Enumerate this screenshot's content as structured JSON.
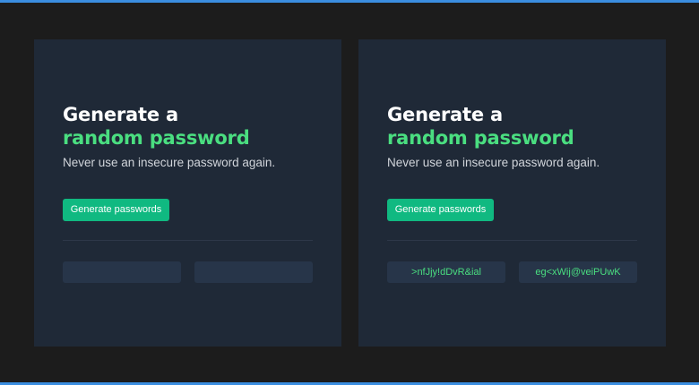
{
  "cards": [
    {
      "title_line1": "Generate a",
      "title_line2": "random password",
      "subtitle": "Never use an insecure password again.",
      "button_label": "Generate passwords",
      "passwords": [
        "",
        ""
      ]
    },
    {
      "title_line1": "Generate a",
      "title_line2": "random password",
      "subtitle": "Never use an insecure password again.",
      "button_label": "Generate passwords",
      "passwords": [
        ">nfJjy!dDvR&ial",
        "eg<xWij@veiPUwK"
      ]
    }
  ],
  "colors": {
    "page_background": "#1c1c1c",
    "card_background": "#1f2937",
    "accent_green": "#4ade80",
    "button_green": "#10b981",
    "password_box": "#273549",
    "frame_blue": "#3b8ee0"
  }
}
